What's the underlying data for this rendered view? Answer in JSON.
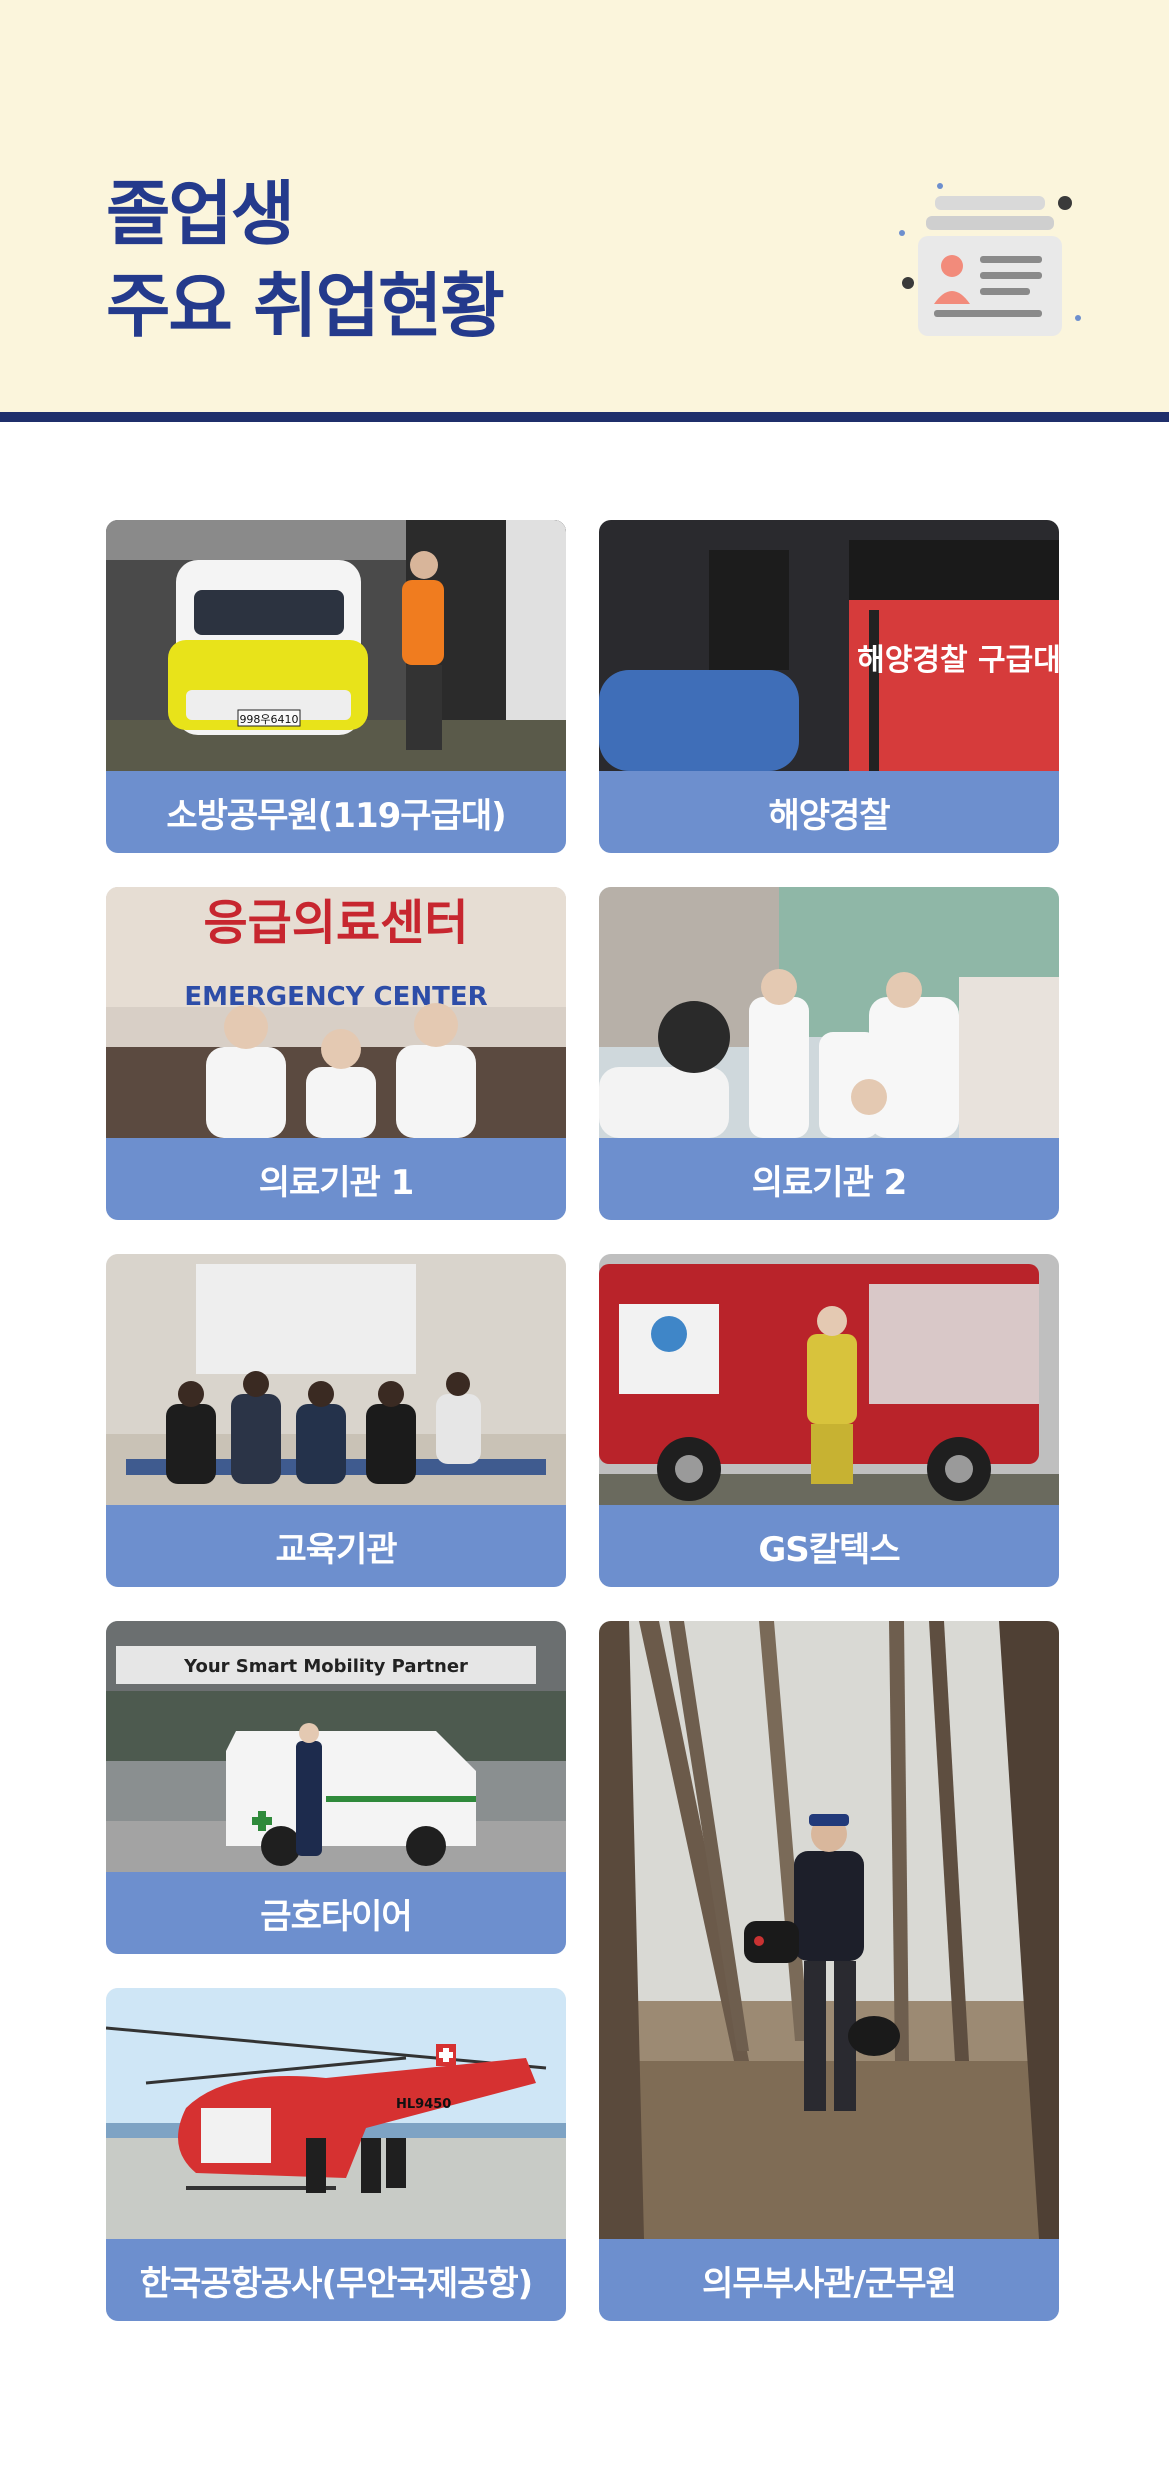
{
  "header": {
    "title_line1": "졸업생",
    "title_line2": "주요 취업현황",
    "icon": "id-card-icon",
    "colors": {
      "background": "#fbf5dc",
      "title": "#243a8c",
      "rule": "#1f2f6b",
      "caption_bar": "#6d8fce"
    }
  },
  "cards": [
    {
      "caption": "소방공무원(119구급대)",
      "photo": "ambulance-firefighter-photo"
    },
    {
      "caption": "해양경찰",
      "photo": "coast-guard-vest-photo"
    },
    {
      "caption": "의료기관 1",
      "photo": "emergency-center-photo"
    },
    {
      "caption": "의료기관 2",
      "photo": "hospital-staff-photo"
    },
    {
      "caption": "교육기관",
      "photo": "cpr-training-photo"
    },
    {
      "caption": "GS칼텍스",
      "photo": "fire-truck-photo"
    },
    {
      "caption": "금호타이어",
      "photo": "company-ambulance-photo"
    },
    {
      "caption": "의무부사관/군무원",
      "photo": "soldier-forest-photo"
    },
    {
      "caption": "한국공항공사(무안국제공항)",
      "photo": "rescue-helicopter-photo"
    }
  ],
  "photo_text": {
    "emergency_sign_ko": "응급의료센터",
    "emergency_sign_en": "EMERGENCY CENTER",
    "mobility_sign": "Your Smart Mobility Partner",
    "helicopter_reg": "HL9450",
    "plate": "998우6410",
    "vest_text": "해양경찰 구급대"
  }
}
